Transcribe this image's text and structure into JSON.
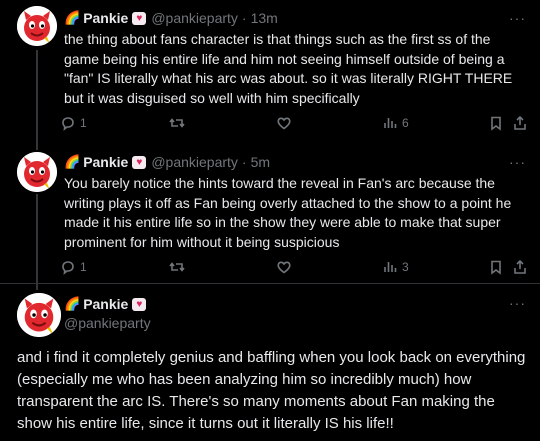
{
  "tweets": [
    {
      "name": "Pankie",
      "handle": "@pankieparty",
      "time": "13m",
      "text": "the thing about fans character is that things such as the first ss of the game being his entire life and him not seeing himself outside of being a \"fan\" IS literally what his arc was about. so it was literally RIGHT THERE but it was disguised so well with him specifically",
      "replies": "1",
      "retweets": "",
      "likes": "",
      "views": "6"
    },
    {
      "name": "Pankie",
      "handle": "@pankieparty",
      "time": "5m",
      "text": "You barely notice the hints toward the reveal in Fan's arc because the writing plays it off as Fan being overly attached to the show to a point he made it his entire life so in the show they were able to make that super prominent for him without it being suspicious",
      "replies": "1",
      "retweets": "",
      "likes": "",
      "views": "3"
    }
  ],
  "main_tweet": {
    "name": "Pankie",
    "handle": "@pankieparty",
    "text": "and i find it completely genius and baffling when you look back on everything (especially me who has been analyzing him so incredibly much) how transparent the arc IS. There's so many moments about Fan making the show his entire life, since it turns out it literally IS his life!!"
  },
  "ui": {
    "dot": "·",
    "more": "···",
    "rainbow": "🌈",
    "heart": "♥"
  },
  "icons": [
    "reply-icon",
    "retweet-icon",
    "like-icon",
    "views-icon",
    "bookmark-icon",
    "share-icon",
    "more-icon",
    "avatar-devil-icon"
  ],
  "colors": {
    "background": "#000000",
    "text": "#e7e9ea",
    "muted": "#71767b",
    "divider": "#2f3336",
    "avatar_red": "#e0282e"
  }
}
